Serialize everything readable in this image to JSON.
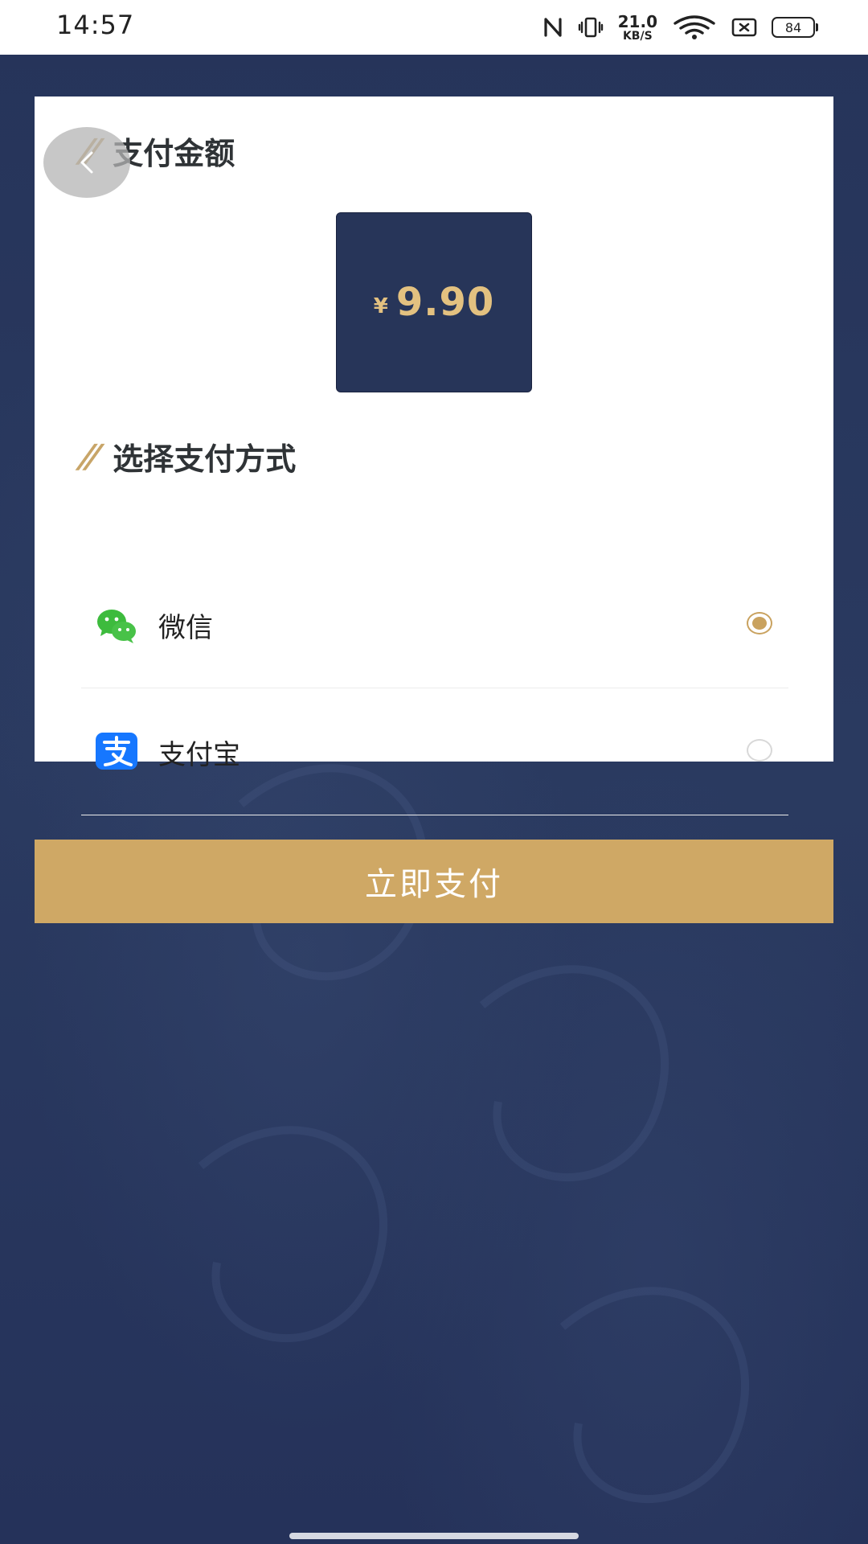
{
  "status_bar": {
    "time": "14:57",
    "speed_value": "21.0",
    "speed_unit": "KB/S",
    "battery": "84"
  },
  "payment": {
    "amount_title": "支付金额",
    "currency_symbol": "¥",
    "amount": "9.90",
    "method_title": "选择支付方式",
    "methods": [
      {
        "label": "微信",
        "icon": "wechat-icon",
        "selected": true
      },
      {
        "label": "支付宝",
        "icon": "alipay-icon",
        "selected": false
      }
    ],
    "pay_button_label": "立即支付"
  },
  "colors": {
    "background": "#263457",
    "accent_gold": "#cfa865",
    "amount_box": "#273559",
    "wechat_green": "#3dbb3d",
    "alipay_blue": "#1677ff"
  }
}
